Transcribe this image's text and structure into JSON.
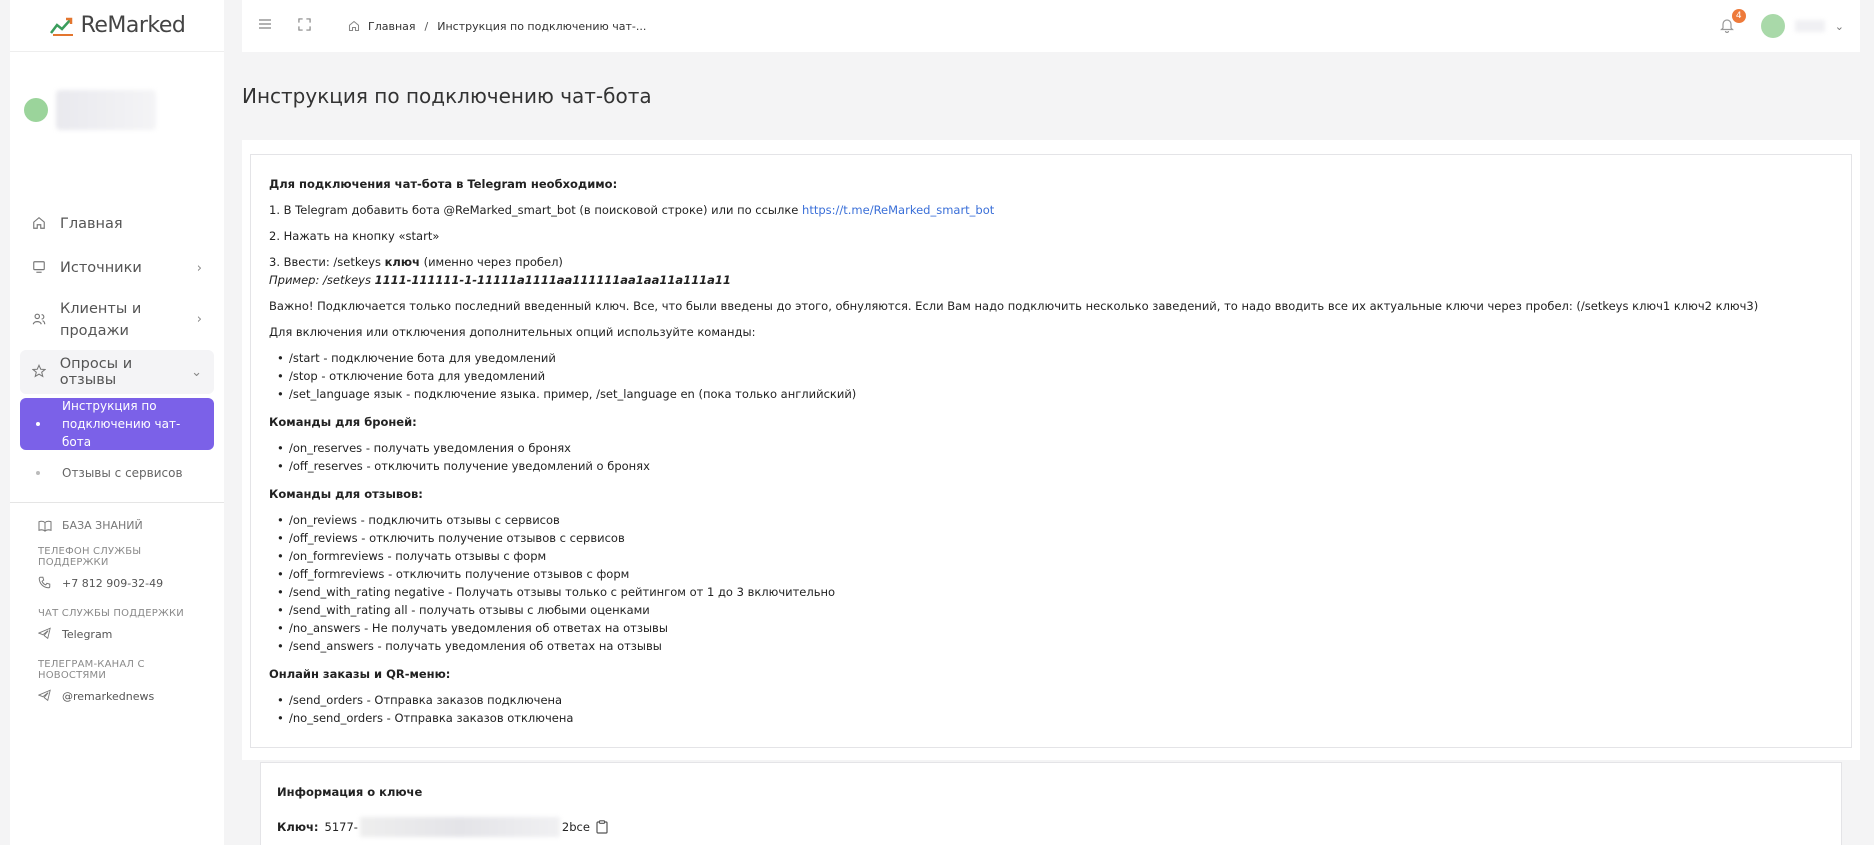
{
  "brand": {
    "name": "ReMarked"
  },
  "sidebar": {
    "items": [
      {
        "label": "Главная",
        "icon": "home-icon"
      },
      {
        "label": "Источники",
        "icon": "monitor-icon"
      },
      {
        "label": "Клиенты и продажи",
        "icon": "users-icon"
      },
      {
        "label": "Опросы и отзывы",
        "icon": "star-icon"
      }
    ],
    "subitems": [
      {
        "label": "Инструкция по подключению чат-бота"
      },
      {
        "label": "Отзывы с сервисов"
      }
    ],
    "footer": {
      "knowledge_base": "БАЗА ЗНАНИЙ",
      "phone_head": "ТЕЛЕФОН СЛУЖБЫ ПОДДЕРЖКИ",
      "phone": "+7 812 909-32-49",
      "chat_head": "ЧАТ СЛУЖБЫ ПОДДЕРЖКИ",
      "chat": "Telegram",
      "news_head": "ТЕЛЕГРАМ-КАНАЛ С НОВОСТЯМИ",
      "news": "@remarkednews"
    }
  },
  "topbar": {
    "breadcrumb_home": "Главная",
    "breadcrumb_sep": "/",
    "breadcrumb_current": "Инструкция по подключению чат-...",
    "notifications_count": "4"
  },
  "page": {
    "title": "Инструкция по подключению чат-бота"
  },
  "instructions": {
    "intro": "Для подключения чат-бота в Telegram необходимо:",
    "step1_text": "1. В Telegram добавить бота @ReMarked_smart_bot (в поисковой строке) или по ссылке ",
    "step1_link": "https://t.me/ReMarked_smart_bot",
    "step2": "2. Нажать на кнопку «start»",
    "step3_a": "3. Ввести: /setkeys ",
    "step3_b": "ключ",
    "step3_c": " (именно через пробел)",
    "example_a": "Пример: /setkeys ",
    "example_b": "1111-111111-1-11111a1111aa111111aa1aa11a111a11",
    "important": "Важно! Подключается только последний введенный ключ. Все, что были введены до этого, обнуляются. Если Вам надо подключить несколько заведений, то надо вводить все их актуальные ключи через пробел: (/setkeys ключ1 ключ2 ключ3)",
    "options_head": "Для включения или отключения дополнительных опций используйте команды:",
    "options": [
      "/start - подключение бота для уведомлений",
      "/stop - отключение бота для уведомлений",
      "/set_language язык - подключение языка. пример, /set_language en (пока только английский)"
    ],
    "reserves_head": "Команды для броней:",
    "reserves": [
      "/on_reserves - получать уведомления о бронях",
      "/off_reserves - отключить получение уведомлений о бронях"
    ],
    "reviews_head": "Команды для отзывов:",
    "reviews": [
      "/on_reviews - подключить отзывы с сервисов",
      "/off_reviews - отключить получение отзывов с сервисов",
      "/on_formreviews - получать отзывы с форм",
      "/off_formreviews - отключить получение отзывов с форм",
      "/send_with_rating negative - Получать отзывы только с рейтингом от 1 до 3 включительно",
      "/send_with_rating all - получать отзывы с любыми оценками",
      "/no_answers - Не получать уведомления об ответах на отзывы",
      "/send_answers - получать уведомления об ответах на отзывы"
    ],
    "orders_head": "Онлайн заказы и QR-меню:",
    "orders": [
      "/send_orders - Отправка заказов подключена",
      "/no_send_orders - Отправка заказов отключена"
    ]
  },
  "key_info": {
    "title": "Информация о ключе",
    "label": "Ключ:",
    "prefix": "5177-",
    "suffix": "2bce"
  }
}
